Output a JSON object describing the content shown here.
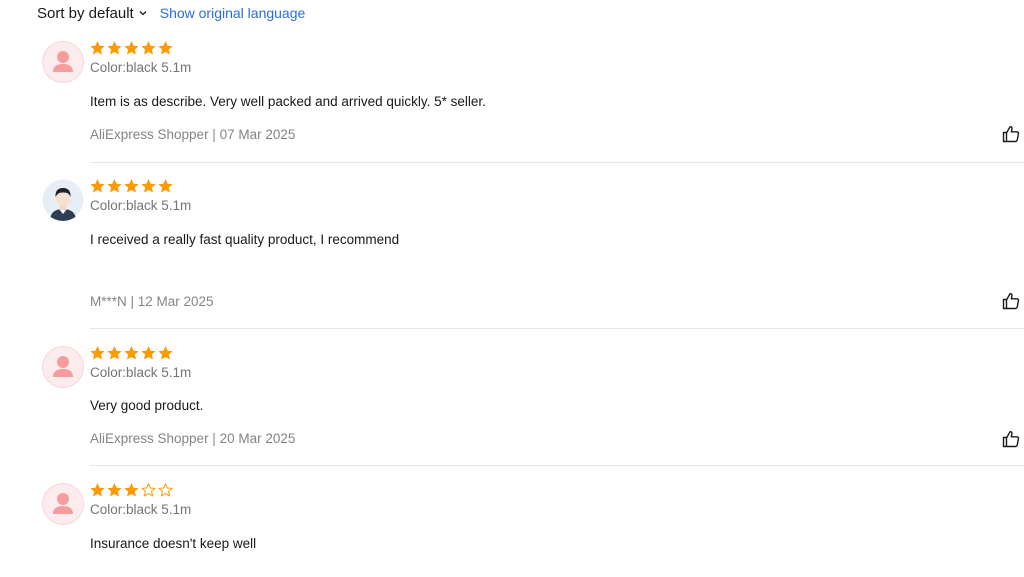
{
  "toolbar": {
    "sort_label": "Sort by default",
    "sort_icon": "chevron-down-icon",
    "language_link": "Show original language"
  },
  "colors": {
    "star": "#fd9a00",
    "link": "#2a6ce5",
    "divider": "#e6e6e6"
  },
  "reviews": [
    {
      "avatar": "default-avatar",
      "rating": 5,
      "max_rating": 5,
      "sku": "Color:black 5.1m",
      "text": "Item is as describe. Very well packed and arrived quickly. 5* seller.",
      "meta": "AliExpress Shopper | 07 Mar 2025",
      "like_icon": "thumbs-up-icon"
    },
    {
      "avatar": "user-avatar",
      "rating": 5,
      "max_rating": 5,
      "sku": "Color:black 5.1m",
      "text": "I received a really fast quality product, I recommend",
      "meta": "M***N | 12 Mar 2025",
      "like_icon": "thumbs-up-icon"
    },
    {
      "avatar": "default-avatar",
      "rating": 5,
      "max_rating": 5,
      "sku": "Color:black 5.1m",
      "text": "Very good product.",
      "meta": "AliExpress Shopper | 20 Mar 2025",
      "like_icon": "thumbs-up-icon"
    },
    {
      "avatar": "default-avatar",
      "rating": 3,
      "max_rating": 5,
      "sku": "Color:black 5.1m",
      "text": "Insurance doesn't keep well"
    }
  ]
}
